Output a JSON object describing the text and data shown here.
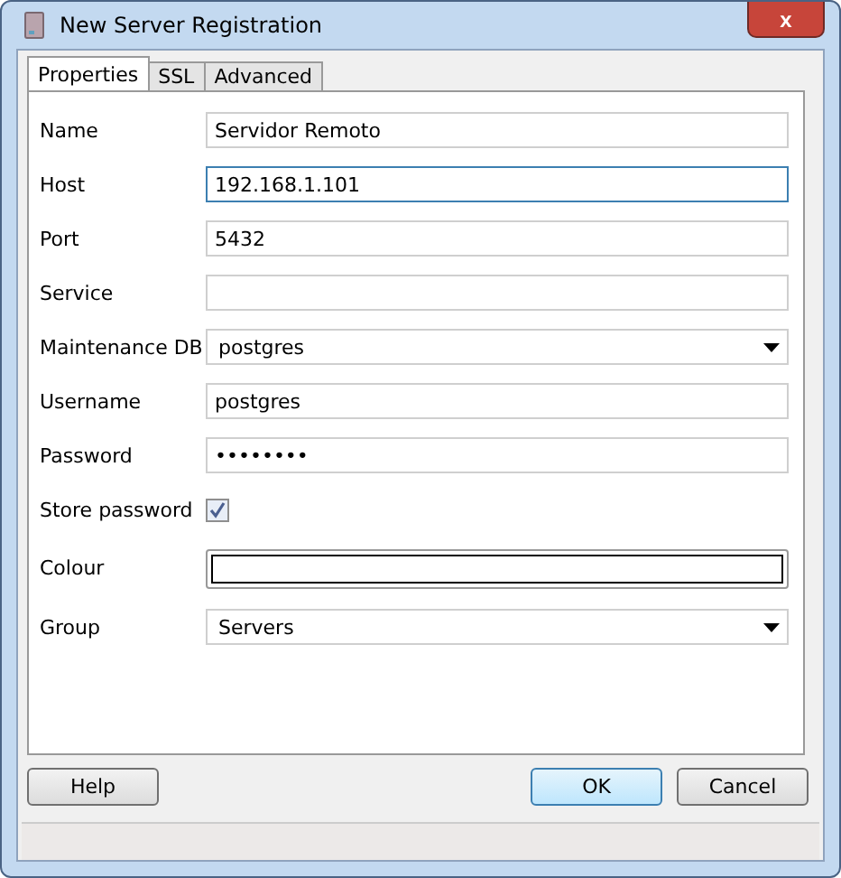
{
  "window": {
    "title": "New Server Registration",
    "close": "x"
  },
  "tabs": [
    {
      "label": "Properties",
      "selected": true
    },
    {
      "label": "SSL",
      "selected": false
    },
    {
      "label": "Advanced",
      "selected": false
    }
  ],
  "fields": [
    {
      "kind": "text",
      "label": "Name",
      "value": "Servidor Remoto",
      "focused": false
    },
    {
      "kind": "text",
      "label": "Host",
      "value": "192.168.1.101",
      "focused": true
    },
    {
      "kind": "text",
      "label": "Port",
      "value": "5432",
      "focused": false
    },
    {
      "kind": "text",
      "label": "Service",
      "focused": false
    },
    {
      "kind": "combo",
      "label": "Maintenance DB",
      "value": "postgres"
    },
    {
      "kind": "text",
      "label": "Username",
      "value": "postgres",
      "focused": false
    },
    {
      "kind": "text",
      "label": "Password",
      "value": "••••••••",
      "focused": false
    },
    {
      "kind": "checkbox",
      "label": "Store password",
      "checked": true
    },
    {
      "kind": "colour",
      "label": "Colour"
    },
    {
      "kind": "combo",
      "label": "Group",
      "value": "Servers"
    }
  ],
  "buttons": [
    {
      "label": "Help",
      "default": false
    },
    {
      "label": "OK",
      "default": true
    },
    {
      "label": "Cancel",
      "default": false
    }
  ]
}
